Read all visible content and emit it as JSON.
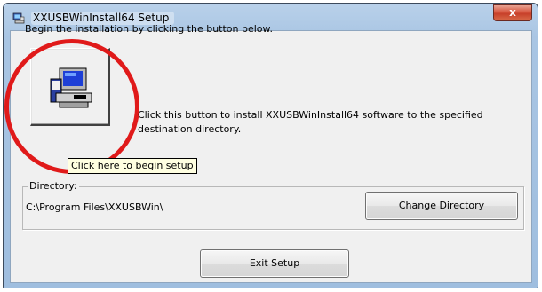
{
  "window": {
    "title": "XXUSBWinInstall64 Setup",
    "title_icon": "setup-computer-icon",
    "close_glyph": "x"
  },
  "main": {
    "intro_text": "Begin the installation by clicking the button below.",
    "install_button_icon": "computer-install-icon",
    "install_description": "Click this button to install XXUSBWinInstall64 software to the specified destination directory.",
    "tooltip_text": "Click here to begin setup"
  },
  "directory": {
    "group_label": "Directory:",
    "path": "C:\\Program Files\\XXUSBWin\\",
    "change_button_label": "Change Directory"
  },
  "footer": {
    "exit_button_label": "Exit Setup"
  },
  "colors": {
    "annotation_circle": "#e01a1a",
    "close_button": "#d7563f",
    "tooltip_background": "#ffffe1"
  }
}
